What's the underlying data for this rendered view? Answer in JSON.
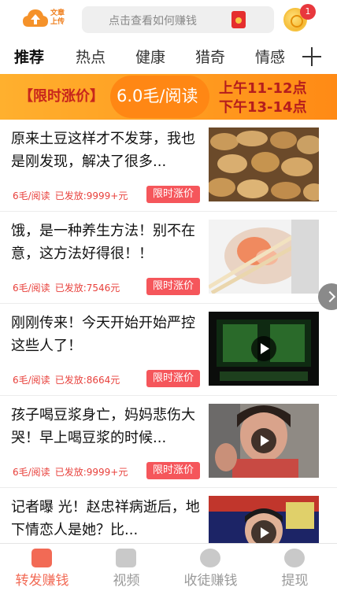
{
  "header": {
    "logo_text": "文章上传",
    "search_placeholder": "点击查看如何赚钱",
    "notification_count": "1"
  },
  "tabs": [
    {
      "label": "推荐",
      "active": true
    },
    {
      "label": "热点",
      "active": false
    },
    {
      "label": "健康",
      "active": false
    },
    {
      "label": "猎奇",
      "active": false
    },
    {
      "label": "情感",
      "active": false
    }
  ],
  "banner": {
    "left": "【限时涨价】",
    "price": "6.0毛/阅读",
    "line1": "上午11-12点",
    "line2": "下午13-14点"
  },
  "articles": [
    {
      "title": "原来土豆这样才不发芽，我也是刚发现，解决了很多...",
      "rate": "6毛/阅读",
      "sent": "已发放:9999+元",
      "tag": "限时涨价",
      "thumb": "potato-image",
      "video": false
    },
    {
      "title": "饿，是一种养生方法！别不在意，这方法好得很！！",
      "rate": "6毛/阅读",
      "sent": "已发放:7546元",
      "tag": "限时涨价",
      "thumb": "food-image",
      "video": false
    },
    {
      "title": "刚刚传来！今天开始开始严控这些人了！",
      "rate": "6毛/阅读",
      "sent": "已发放:8664元",
      "tag": "限时涨价",
      "thumb": "warning-image",
      "video": true
    },
    {
      "title": "孩子喝豆浆身亡，妈妈悲伤大哭！早上喝豆浆的时候...",
      "rate": "6毛/阅读",
      "sent": "已发放:9999+元",
      "tag": "限时涨价",
      "thumb": "crying-woman-image",
      "video": true
    },
    {
      "title": "记者曝 光！赵忠祥病逝后，地下情恋人是她？比...",
      "rate": "",
      "sent": "",
      "tag": "",
      "thumb": "host-image",
      "video": true
    }
  ],
  "bottom_nav": [
    {
      "label": "转发赚钱",
      "active": true,
      "icon": "share-icon"
    },
    {
      "label": "视频",
      "active": false,
      "icon": "video-icon"
    },
    {
      "label": "收徒赚钱",
      "active": false,
      "icon": "user-icon"
    },
    {
      "label": "提现",
      "active": false,
      "icon": "wallet-icon"
    }
  ]
}
